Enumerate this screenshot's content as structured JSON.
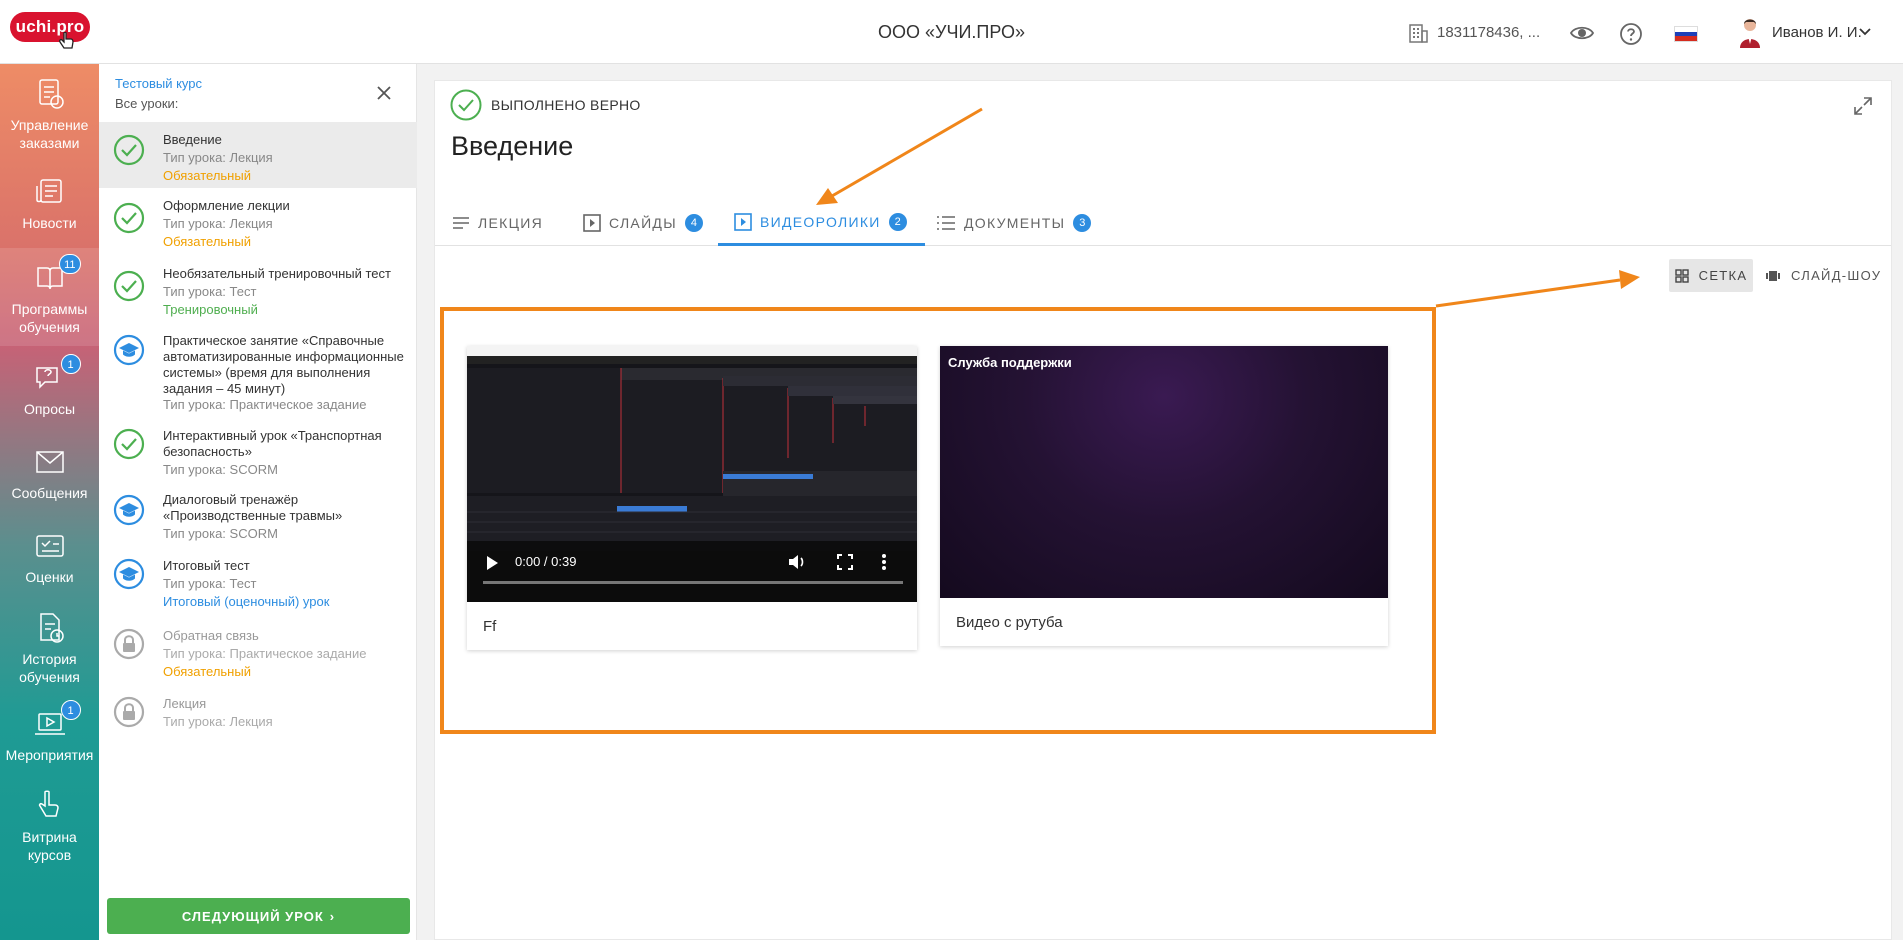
{
  "header": {
    "logo_text": "uchi.pro",
    "org_title": "ООО «УЧИ.ПРО»",
    "account": "1831178436, ...",
    "user_name": "Иванов И. И."
  },
  "rail": [
    {
      "label": "Управление заказами",
      "icon": "orders-icon",
      "badge": ""
    },
    {
      "label": "Новости",
      "icon": "news-icon",
      "badge": ""
    },
    {
      "label": "Программы обучения",
      "icon": "programs-icon",
      "badge": "11"
    },
    {
      "label": "Опросы",
      "icon": "surveys-icon",
      "badge": "1"
    },
    {
      "label": "Сообщения",
      "icon": "messages-icon",
      "badge": ""
    },
    {
      "label": "Оценки",
      "icon": "grades-icon",
      "badge": ""
    },
    {
      "label": "История обучения",
      "icon": "history-icon",
      "badge": ""
    },
    {
      "label": "Мероприятия",
      "icon": "events-icon",
      "badge": "1"
    },
    {
      "label": "Витрина курсов",
      "icon": "showcase-icon",
      "badge": ""
    }
  ],
  "sidebar": {
    "course_link": "Тестовый курс",
    "all_lessons": "Все уроки:",
    "lessons": [
      {
        "title": "Введение",
        "type": "Тип урока: Лекция",
        "tag": "Обязательный",
        "tag_color": "orange",
        "status": "done"
      },
      {
        "title": "Оформление лекции",
        "type": "Тип урока: Лекция",
        "tag": "Обязательный",
        "tag_color": "orange",
        "status": "done"
      },
      {
        "title": "Необязательный тренировочный тест",
        "type": "Тип урока: Тест",
        "tag": "Тренировочный",
        "tag_color": "green",
        "status": "done"
      },
      {
        "title": "Практическое занятие «Справочные автоматизированные информационные системы» (время для выполнения задания – 45 минут)",
        "type": "Тип урока: Практическое задание",
        "tag": "",
        "status": "in-progress"
      },
      {
        "title": "Интерактивный урок «Транспортная безопасность»",
        "type": "Тип урока: SCORM",
        "tag": "",
        "status": "done"
      },
      {
        "title": "Диалоговый тренажёр «Производственные травмы»",
        "type": "Тип урока: SCORM",
        "tag": "",
        "status": "in-progress"
      },
      {
        "title": "Итоговый тест",
        "type": "Тип урока: Тест",
        "tag": "Итоговый (оценочный) урок",
        "tag_color": "blue",
        "status": "in-progress"
      },
      {
        "title": "Обратная связь",
        "type": "Тип урока: Практическое задание",
        "tag": "Обязательный",
        "tag_color": "orange",
        "status": "locked"
      },
      {
        "title": "Лекция",
        "type": "Тип урока: Лекция",
        "tag": "",
        "status": "locked"
      }
    ],
    "next_button": "СЛЕДУЮЩИЙ УРОК"
  },
  "main": {
    "status_text": "ВЫПОЛНЕНО ВЕРНО",
    "title": "Введение",
    "tabs": [
      {
        "label": "ЛЕКЦИЯ",
        "badge": ""
      },
      {
        "label": "СЛАЙДЫ",
        "badge": "4"
      },
      {
        "label": "ВИДЕОРОЛИКИ",
        "badge": "2"
      },
      {
        "label": "ДОКУМЕНТЫ",
        "badge": "3"
      }
    ],
    "view_grid": "СЕТКА",
    "view_slides": "СЛАЙД-ШОУ",
    "videos": [
      {
        "caption": "Ff",
        "time": "0:00 / 0:39"
      },
      {
        "caption": "Видео с рутуба",
        "overlay": "Служба поддержки"
      }
    ]
  },
  "colors": {
    "accent": "#2d8de0",
    "success": "#4caf50",
    "required": "#f0a000",
    "annotation": "#f0861a",
    "brand": "#d9132f"
  }
}
